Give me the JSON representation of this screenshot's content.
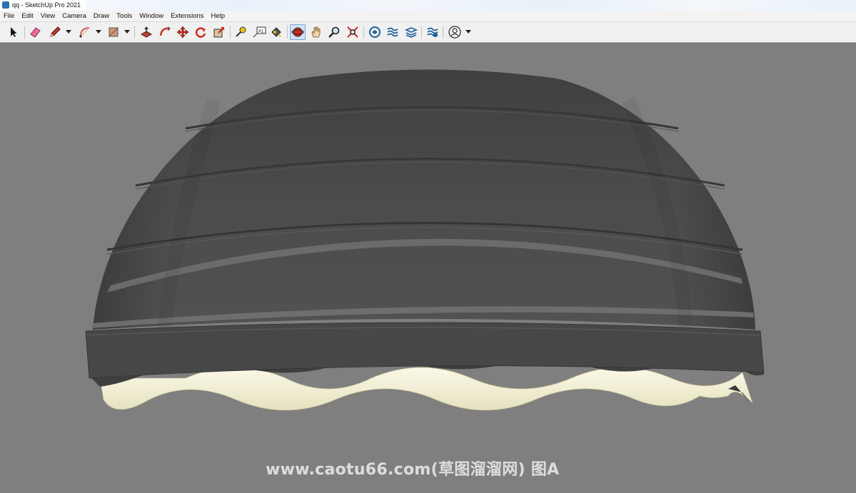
{
  "window": {
    "title": "qq - SketchUp Pro 2021",
    "app_icon": "sketchup-logo-icon"
  },
  "menu": [
    "File",
    "Edit",
    "View",
    "Camera",
    "Draw",
    "Tools",
    "Window",
    "Extensions",
    "Help"
  ],
  "toolbar": {
    "tools": [
      {
        "name": "select-tool",
        "icon": "arrow-icon"
      },
      {
        "name": "eraser-tool",
        "icon": "eraser-icon"
      },
      {
        "name": "line-tool",
        "icon": "pencil-icon",
        "dropdown": true
      },
      {
        "name": "arc-tool",
        "icon": "arc-icon",
        "dropdown": true
      },
      {
        "name": "rectangle-tool",
        "icon": "rectangle-icon",
        "dropdown": true
      },
      {
        "name": "push-pull-tool",
        "icon": "push-pull-icon"
      },
      {
        "name": "follow-me-tool",
        "icon": "follow-me-icon"
      },
      {
        "name": "move-tool",
        "icon": "move-icon"
      },
      {
        "name": "rotate-tool",
        "icon": "rotate-icon"
      },
      {
        "name": "scale-tool",
        "icon": "scale-icon"
      },
      {
        "name": "tape-measure-tool",
        "icon": "tape-measure-icon"
      },
      {
        "name": "text-tool",
        "icon": "text-icon"
      },
      {
        "name": "paint-bucket-tool",
        "icon": "paint-bucket-icon"
      },
      {
        "name": "orbit-tool",
        "icon": "orbit-icon",
        "active": true
      },
      {
        "name": "pan-tool",
        "icon": "hand-icon"
      },
      {
        "name": "zoom-tool",
        "icon": "magnifier-icon"
      },
      {
        "name": "zoom-extents-tool",
        "icon": "zoom-extents-icon"
      },
      {
        "name": "3d-warehouse-tool",
        "icon": "warehouse-icon"
      },
      {
        "name": "extension-warehouse-tool",
        "icon": "extension-warehouse-icon"
      },
      {
        "name": "layout-tool",
        "icon": "layout-icon"
      },
      {
        "name": "extension-manager-tool",
        "icon": "extension-manager-icon"
      },
      {
        "name": "account-menu",
        "icon": "user-icon",
        "dropdown": true
      }
    ]
  },
  "viewport": {
    "background": "#7f7f7f",
    "model": {
      "dome_color": "#4a4a4a",
      "band_color": "#6a6a6a",
      "fringe_color": "#f3f1d6"
    },
    "watermark": "www.caotu66.com(草图溜溜网) 图A"
  }
}
